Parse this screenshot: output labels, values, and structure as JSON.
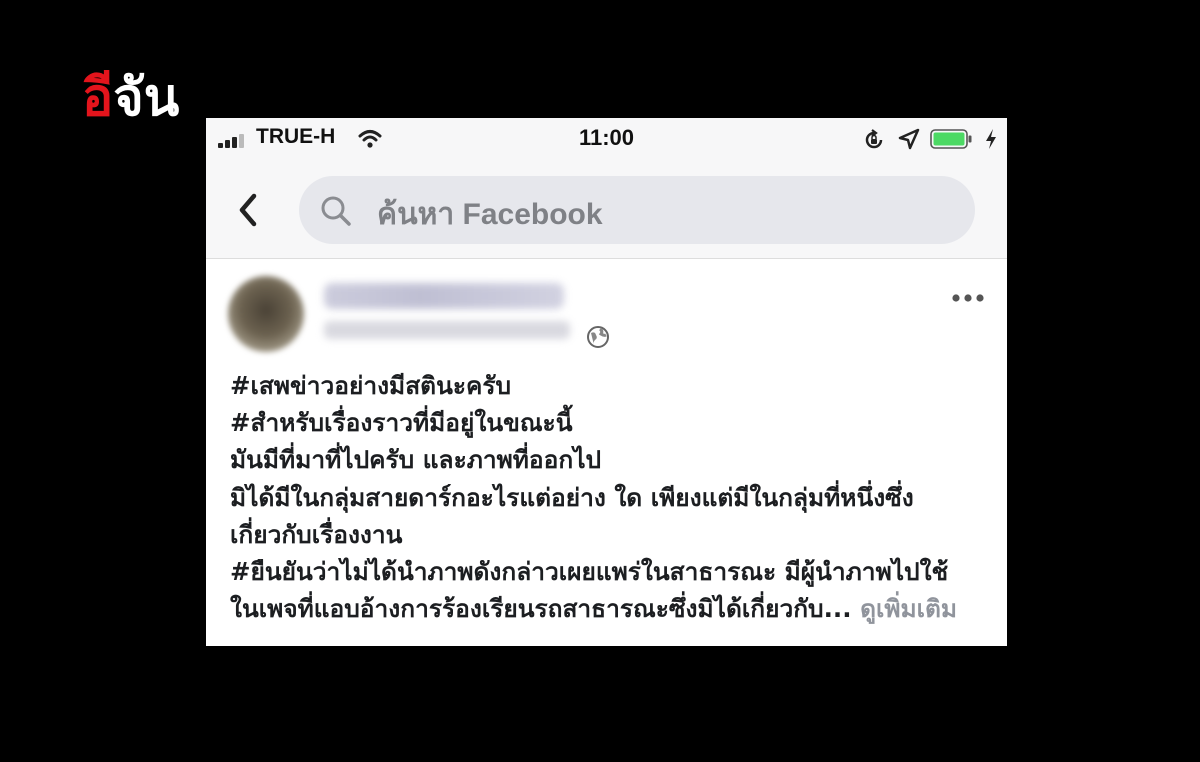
{
  "logo": {
    "part1": "อี",
    "part2": "จัน"
  },
  "status_bar": {
    "carrier": "TRUE-H",
    "time": "11:00"
  },
  "search": {
    "placeholder": "ค้นหา Facebook"
  },
  "post": {
    "lines": [
      "#เสพข่าวอย่างมีสตินะครับ",
      "#สำหรับเรื่องราวที่มีอยู่ในขณะนี้",
      "มันมีที่มาที่ไปครับ  และภาพที่ออกไป",
      "มิได้มีในกลุ่มสายดาร์กอะไรแต่อย่าง ใด เพียงแต่มีในกลุ่มที่หนึ่งซึ่ง",
      "เกี่ยวกับเรื่องงาน",
      "#ยืนยันว่าไม่ได้นำภาพดังกล่าวเผยแพร่ในสาธารณะ มีผู้นำภาพไปใช้"
    ],
    "last_line": "ในเพจที่แอบอ้างการร้องเรียนรถสาธารณะซึ่งมิได้เกี่ยวกับ...",
    "see_more": "ดูเพิ่มเติม"
  }
}
